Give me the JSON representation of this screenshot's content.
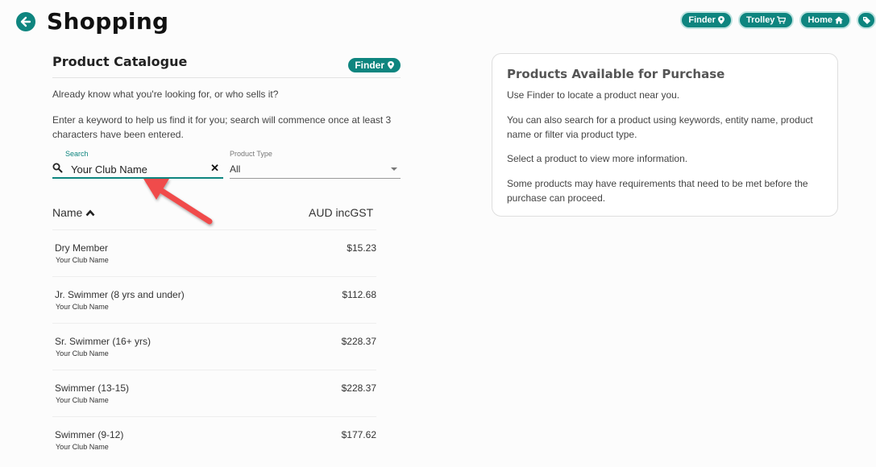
{
  "header": {
    "title": "Shopping"
  },
  "top_nav": {
    "finder": "Finder",
    "trolley": "Trolley",
    "home": "Home"
  },
  "catalogue": {
    "title": "Product Catalogue",
    "finder_badge": "Finder",
    "intro": "Already know what you're looking for, or who sells it?",
    "instructions": "Enter a keyword to help us find it for you; search will commence once at least 3 characters have been entered.",
    "search": {
      "label": "Search",
      "value": "Your Club Name"
    },
    "product_type": {
      "label": "Product Type",
      "value": "All"
    },
    "columns": {
      "name": "Name",
      "price": "AUD incGST"
    },
    "products": [
      {
        "name": "Dry Member",
        "club": "Your Club Name",
        "price": "$15.23"
      },
      {
        "name": "Jr. Swimmer (8 yrs and under)",
        "club": "Your Club Name",
        "price": "$112.68"
      },
      {
        "name": "Sr. Swimmer (16+ yrs)",
        "club": "Your Club Name",
        "price": "$228.37"
      },
      {
        "name": "Swimmer (13-15)",
        "club": "Your Club Name",
        "price": "$228.37"
      },
      {
        "name": "Swimmer (9-12)",
        "club": "Your Club Name",
        "price": "$177.62"
      }
    ]
  },
  "info": {
    "title": "Products Available for Purchase",
    "p1": "Use Finder to locate a product near you.",
    "p2": "You can also search for a product using keywords, entity name, product name or filter via product type.",
    "p3": "Select a product to view more information.",
    "p4": "Some products may have requirements that need to be met before the purchase can proceed."
  },
  "colors": {
    "accent": "#0e857f",
    "annotation": "#f04c4c"
  }
}
